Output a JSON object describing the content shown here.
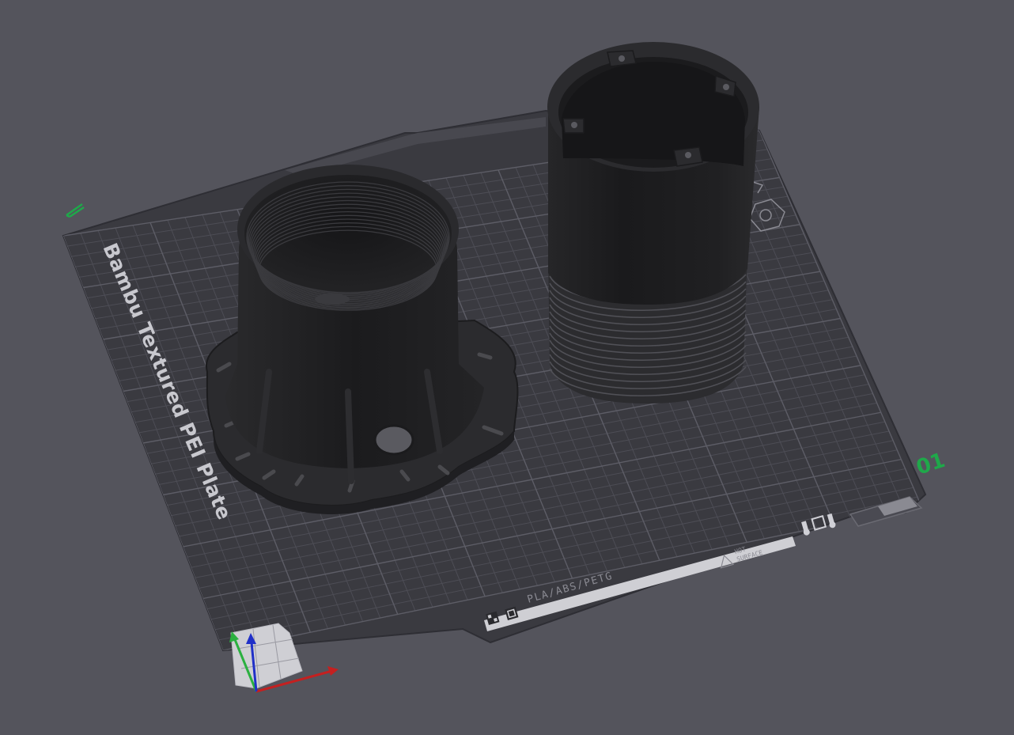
{
  "viewport": {
    "background": "#54545c"
  },
  "plate": {
    "name": "Bambu Textured PEI Plate",
    "number": "01",
    "materials": "PLA/ABS/PETG",
    "warning_line1": "HOT",
    "warning_line2": "SURFACE",
    "surface_color": "#3a3a40",
    "grid_color": "#55555d",
    "accent_green": "#1fa84a",
    "edit_icon": "pencil-edit-icon",
    "logo_icons": [
      "bambu-logo-icon",
      "qr-icon"
    ],
    "rating_icons": [
      "thermometer-icon",
      "square-icon",
      "thermometer-icon"
    ]
  },
  "objects": [
    {
      "name": "threaded-flange-base",
      "color": "#1e1e20"
    },
    {
      "name": "threaded-tube",
      "color": "#1e1e20"
    }
  ],
  "axes": {
    "x_color": "#c42020",
    "y_color": "#2bb040",
    "z_color": "#2030c8"
  }
}
